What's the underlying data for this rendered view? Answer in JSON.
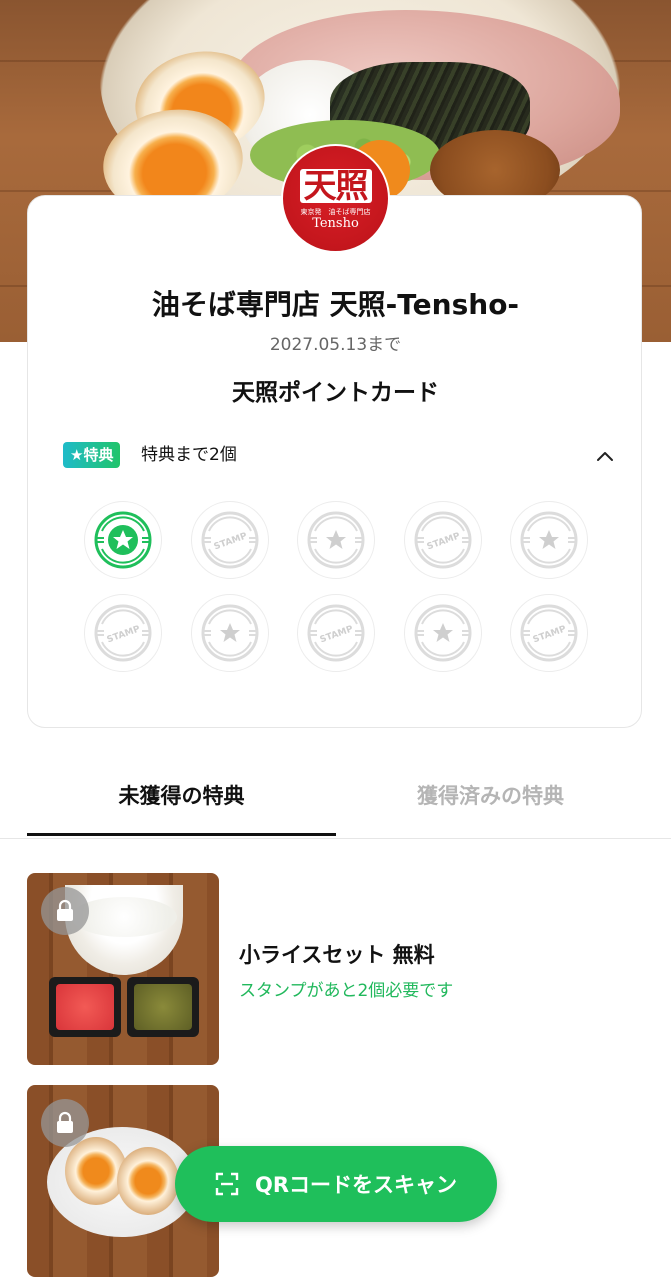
{
  "hero": {
    "image": "ramen-abura-soba-photo"
  },
  "logo": {
    "kanji": "天照",
    "sub": "東京発　油そば専門店",
    "roman": "Tensho"
  },
  "card": {
    "shop_name": "油そば専門店 天照-Tensho-",
    "expiry": "2027.05.13まで",
    "title": "天照ポイントカード",
    "reward_badge": "★特典",
    "reward_progress": "特典まで2個",
    "stamps_collected": 1,
    "stamps_total": 10,
    "stamp_word": "STAMP"
  },
  "tabs": [
    {
      "label": "未獲得の特典",
      "active": true
    },
    {
      "label": "獲得済みの特典",
      "active": false
    }
  ],
  "rewards": [
    {
      "title": "小ライスセット 無料",
      "status": "スタンプがあと2個必要です",
      "image": "rice-set"
    },
    {
      "title": "",
      "status": "",
      "image": "ajitama-egg"
    }
  ],
  "qr_button": {
    "label": "QRコードをスキャン"
  },
  "colors": {
    "accent_green": "#1fbf5b",
    "logo_red": "#c4161d",
    "badge_gradient_start": "#1fbbc9",
    "badge_gradient_end": "#21c46a"
  }
}
